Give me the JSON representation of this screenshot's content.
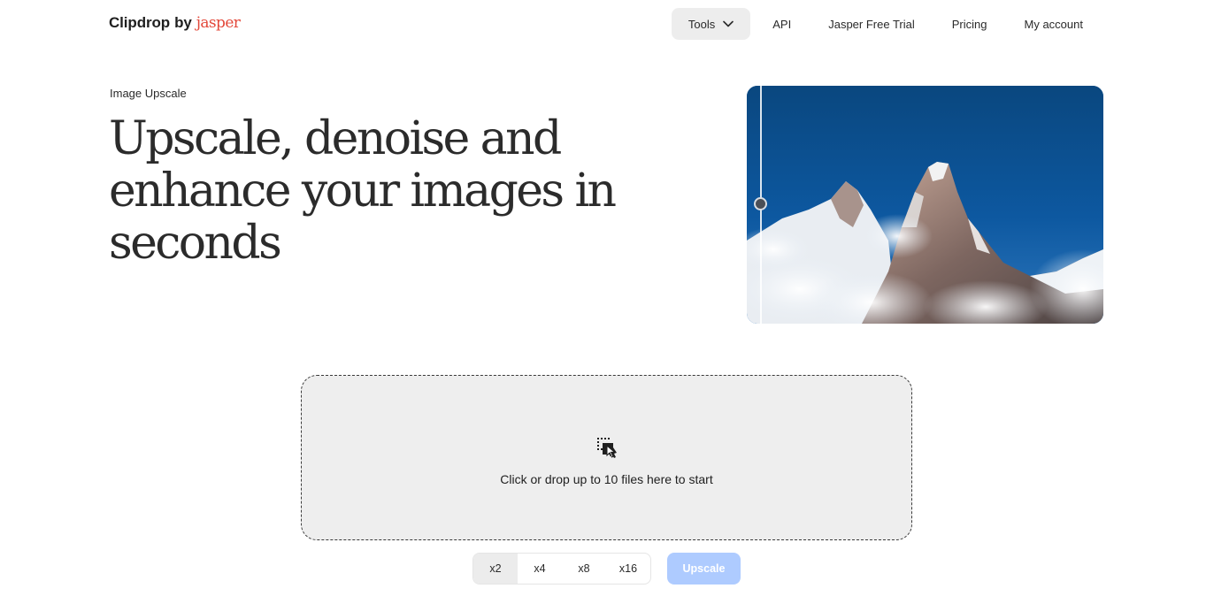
{
  "brand": {
    "name": "Clipdrop",
    "by": "by",
    "partner": "jasper",
    "partner_color": "#e3483a"
  },
  "nav": {
    "items": [
      {
        "label": "Tools",
        "icon": "chevron-down-icon",
        "active": true
      },
      {
        "label": "API"
      },
      {
        "label": "Jasper Free Trial"
      },
      {
        "label": "Pricing"
      },
      {
        "label": "My account"
      }
    ]
  },
  "hero": {
    "eyebrow": "Image Upscale",
    "headline": "Upscale, denoise and enhance your images in seconds",
    "image_alt": "mountain-peaks-comparison"
  },
  "dropzone": {
    "icon": "drop-files-icon",
    "text": "Click or drop up to 10 files here to start"
  },
  "scales": {
    "options": [
      "x2",
      "x4",
      "x8",
      "x16"
    ],
    "selected": "x2"
  },
  "upscale": {
    "label": "Upscale",
    "color": "#aecbff"
  }
}
